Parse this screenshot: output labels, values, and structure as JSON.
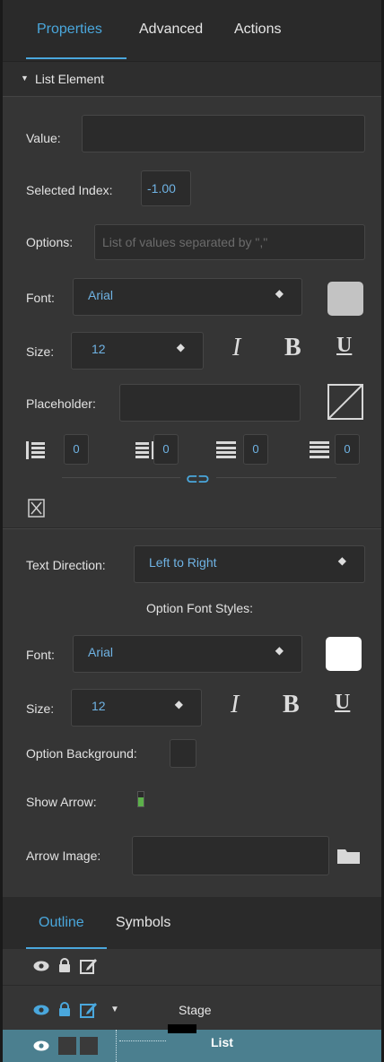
{
  "tabs": {
    "properties": "Properties",
    "advanced": "Advanced",
    "actions": "Actions"
  },
  "section": {
    "title": "List Element"
  },
  "fields": {
    "value_label": "Value:",
    "value": "",
    "selected_index_label": "Selected Index:",
    "selected_index": "-1.00",
    "options_label": "Options:",
    "options_placeholder": "List of values separated by \",\"",
    "font_label": "Font:",
    "font_value": "Arial",
    "size_label": "Size:",
    "size_value": "12",
    "placeholder_label": "Placeholder:",
    "placeholder_value": "",
    "padding_left": "0",
    "padding_right": "0",
    "padding_top": "0",
    "padding_bottom": "0"
  },
  "option_styles": {
    "text_direction_label": "Text Direction:",
    "text_direction_value": "Left to Right",
    "heading": "Option Font Styles:",
    "font_label": "Font:",
    "font_value": "Arial",
    "size_label": "Size:",
    "size_value": "12",
    "background_label": "Option Background:",
    "show_arrow_label": "Show Arrow:",
    "arrow_image_label": "Arrow Image:"
  },
  "style_buttons": {
    "italic": "I",
    "bold": "B",
    "underline": "U"
  },
  "outline": {
    "tabs": {
      "outline": "Outline",
      "symbols": "Symbols"
    },
    "rows": [
      {
        "name": "Stage"
      },
      {
        "name": "List"
      }
    ]
  },
  "colors": {
    "accent": "#4aa7dc",
    "font_swatch": "#c3c3c3",
    "option_font_swatch": "#ffffff",
    "selected_row": "#4b7f8f",
    "toggle_on": "#5cb04a"
  },
  "icons": [
    "dropdown-arrows-icon",
    "no-image-icon",
    "link-icon",
    "reset-icon",
    "folder-icon",
    "eye-icon",
    "lock-icon",
    "edit-icon"
  ]
}
